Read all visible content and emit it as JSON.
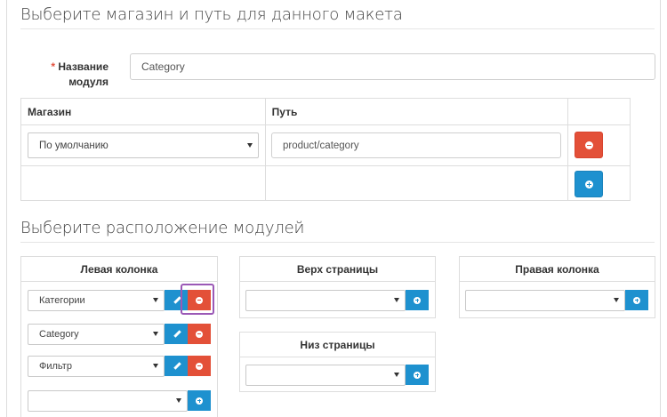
{
  "sections": {
    "store_route_title": "Выберите магазин и путь для данного макета",
    "positions_title": "Выберите расположение модулей"
  },
  "module_name": {
    "required_mark": "*",
    "label_line1": "Название",
    "label_line2": "модуля",
    "value": "Category"
  },
  "routes_table": {
    "col_store": "Магазин",
    "col_route": "Путь",
    "rows": [
      {
        "store": "По умолчанию",
        "route": "product/category"
      }
    ]
  },
  "columns": {
    "left": {
      "title": "Левая колонка",
      "modules": [
        "Категории",
        "Category",
        "Фильтр"
      ]
    },
    "top": {
      "title": "Верх страницы"
    },
    "right": {
      "title": "Правая колонка"
    },
    "bottom": {
      "title": "Низ страницы"
    }
  },
  "colors": {
    "danger": "#e35038",
    "primary": "#1e91cf",
    "highlight": "#9b59b6"
  }
}
